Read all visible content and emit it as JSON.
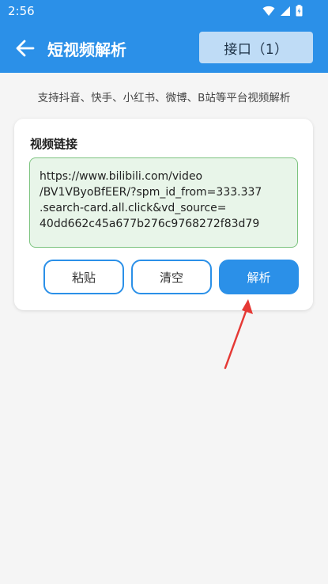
{
  "status_bar": {
    "time": "2:56"
  },
  "app_bar": {
    "title": "短视频解析",
    "interface_button": "接口（1）"
  },
  "subtitle": "支持抖音、快手、小红书、微博、B站等平台视频解析",
  "card": {
    "label": "视频链接",
    "link_value": "https://www.bilibili.com/video\n/BV1VByoBfEER/?spm_id_from=333.337\n.search-card.all.click&vd_source=\n40dd662c45a677b276c9768272f83d79",
    "buttons": {
      "paste": "粘贴",
      "clear": "清空",
      "parse": "解析"
    }
  },
  "colors": {
    "primary": "#2b90e8",
    "annotation_arrow": "#e53935",
    "input_bg": "#e8f5e9",
    "input_border": "#7cc37f"
  }
}
